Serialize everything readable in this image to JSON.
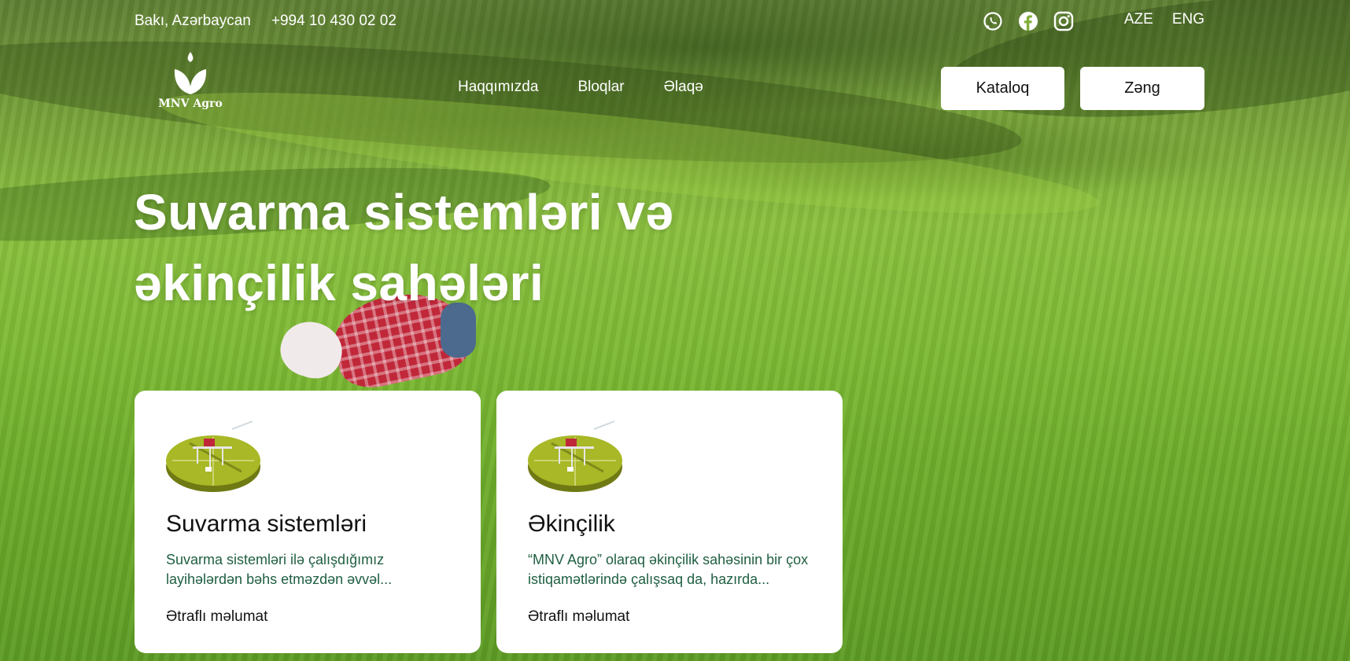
{
  "topbar": {
    "location": "Bakı, Azərbaycan",
    "phone": "+994 10 430 02 02",
    "socials": [
      "whatsapp-icon",
      "facebook-icon",
      "instagram-icon"
    ],
    "languages": [
      "AZE",
      "ENG"
    ]
  },
  "logo": {
    "text": "MNV Agro"
  },
  "nav": {
    "items": [
      "Haqqımızda",
      "Bloqlar",
      "Əlaqə"
    ]
  },
  "actions": {
    "catalog_label": "Kataloq",
    "call_label": "Zəng"
  },
  "hero": {
    "title_line1": "Suvarma sistemləri və",
    "title_line2": "əkinçilik sahələri"
  },
  "cards": [
    {
      "title": "Suvarma sistemləri",
      "description": "Suvarma sistemləri ilə çalışdığımız layihələrdən bəhs etməzdən əvvəl...",
      "link": "Ətraflı məlumat"
    },
    {
      "title": "Əkinçilik",
      "description": "“MNV Agro” olaraq əkinçilik sahəsinin bir çox istiqamətlərində çalışsaq da, hazırda...",
      "link": "Ətraflı məlumat"
    }
  ],
  "colors": {
    "card_text_accent": "#1f5f42",
    "button_bg": "#ffffff",
    "field_green": "#7fbb36"
  }
}
